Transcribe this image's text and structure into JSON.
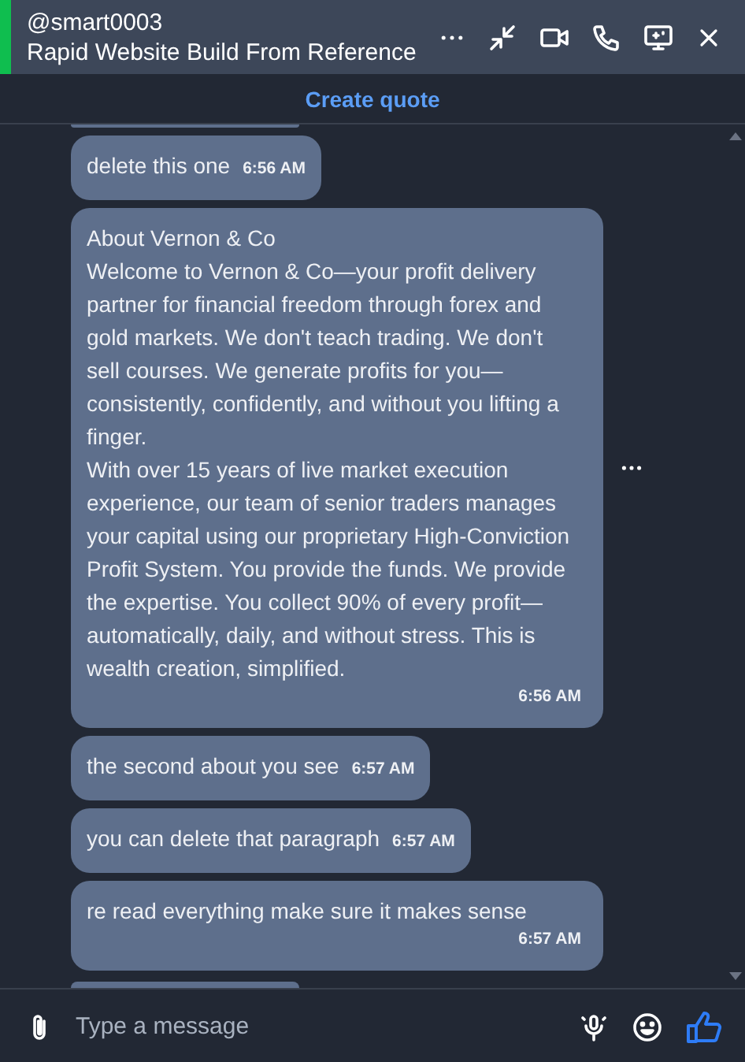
{
  "header": {
    "handle": "@smart0003",
    "title": "Rapid Website Build From Reference"
  },
  "quote_link": "Create quote",
  "messages": [
    {
      "lines": [
        "delete this one"
      ],
      "time": "6:56 AM",
      "kind": "inline"
    },
    {
      "lines": [
        "About Vernon & Co",
        "Welcome to Vernon & Co—your profit delivery partner for financial freedom through forex and gold markets. We don't teach trading. We don't sell courses. We generate profits for you—consistently, confidently, and without you lifting a finger.",
        "With over 15 years of live market execution experience, our team of senior traders manages your capital using our proprietary High-Conviction Profit System. You provide the funds. We provide the expertise. You collect 90% of every profit— automatically, daily, and without stress. This is wealth creation, simplified."
      ],
      "time": "6:56 AM",
      "kind": "block",
      "hovered": true
    },
    {
      "lines": [
        "the second about you see"
      ],
      "time": "6:57 AM",
      "kind": "inline"
    },
    {
      "lines": [
        "you can delete that paragraph"
      ],
      "time": "6:57 AM",
      "kind": "inline"
    },
    {
      "lines": [
        "re read everything make sure it makes sense"
      ],
      "time": "6:57 AM",
      "kind": "block"
    }
  ],
  "composer": {
    "placeholder": "Type a message"
  }
}
